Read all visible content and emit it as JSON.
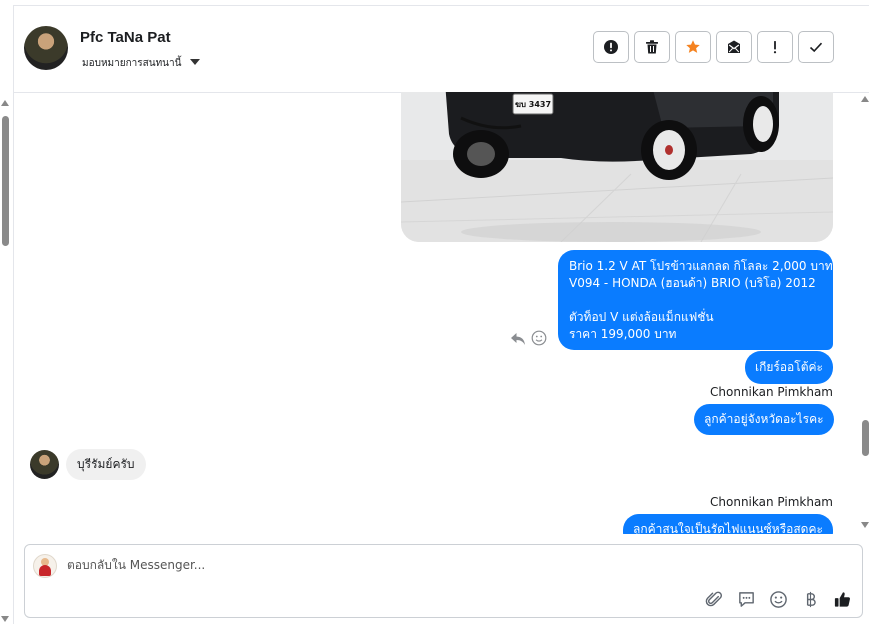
{
  "header": {
    "user_name": "Pfc TaNa Pat",
    "assign_label": "มอบหมายการสนทนานี้",
    "actions": [
      {
        "name": "spam-button",
        "icon": "alert-circle-icon"
      },
      {
        "name": "delete-button",
        "icon": "trash-icon"
      },
      {
        "name": "star-button",
        "icon": "star-icon"
      },
      {
        "name": "mark-unread-button",
        "icon": "envelope-icon"
      },
      {
        "name": "important-button",
        "icon": "exclamation-icon"
      },
      {
        "name": "done-button",
        "icon": "check-icon"
      }
    ]
  },
  "messages": {
    "main_bubble_lines": [
      "Brio 1.2 V AT โปรข้าวแลกลด กิโลละ 2,000 บาท",
      "V094 - HONDA (ฮอนด้า) BRIO (บริโอ) 2012",
      "",
      " ตัวท็อป V แต่งล้อแม็กแฟชั่น",
      "ราคา 199,000 บาท"
    ],
    "gear_bubble": "เกียร์ออโต้ค่ะ",
    "sender_1": "Chonnikan Pimkham",
    "province_bubble": "ลูกค้าอยู่จังหวัดอะไรคะ",
    "incoming_bubble": "บุรีรัมย์ครับ",
    "sender_2": "Chonnikan Pimkham",
    "bottom_bubble": "ลูกค้าสนใจเป็นรัดไฟแนนซ์หรือสดคะ",
    "car_plate": "ฆบ 3437"
  },
  "composer": {
    "placeholder": "ตอบกลับใน Messenger...",
    "value": ""
  },
  "colors": {
    "brand_blue": "#0a7cff",
    "incoming_bubble": "#f0f0f0",
    "star_orange": "#f5821f"
  }
}
